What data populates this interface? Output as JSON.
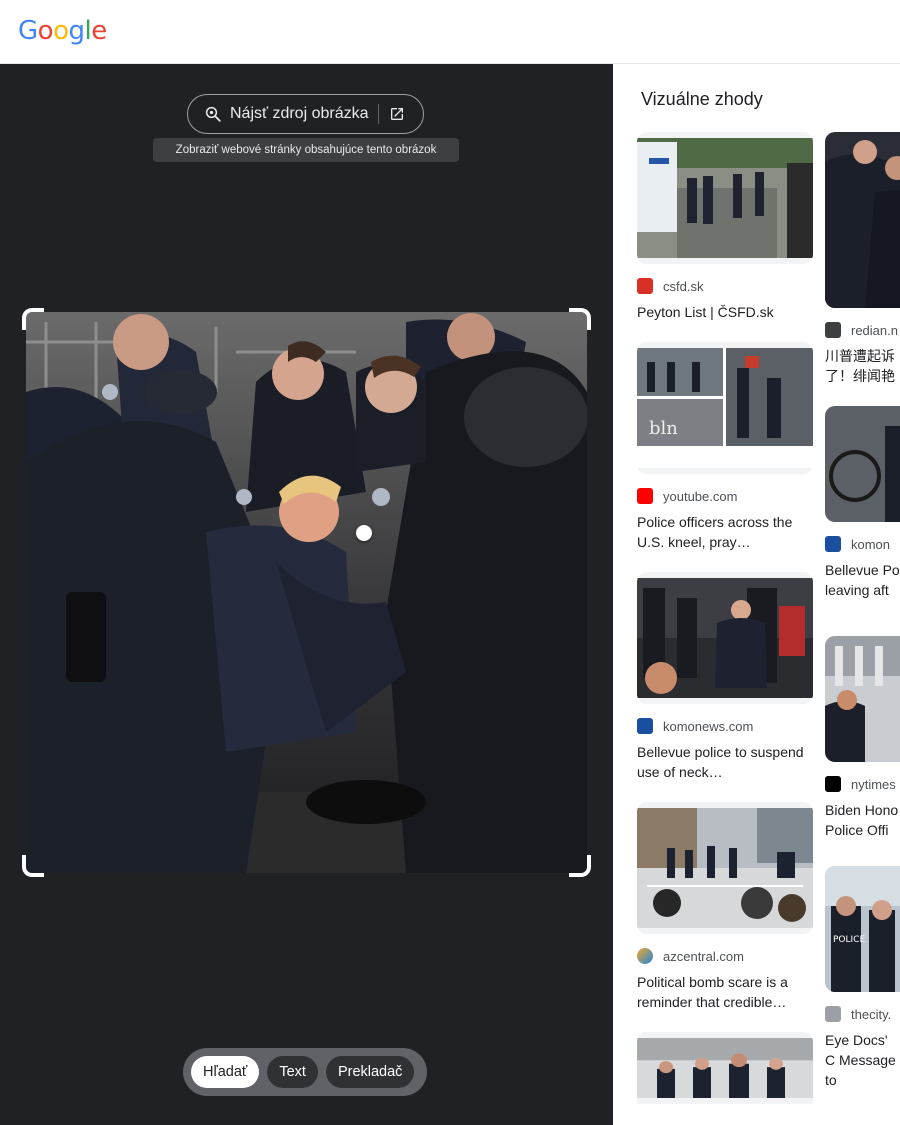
{
  "header": {
    "logo": "Google"
  },
  "left": {
    "find_source_label": "Nájsť zdroj obrázka",
    "tooltip": "Zobraziť webové stránky obsahujúce tento obrázok",
    "modes": [
      "Hľadať",
      "Text",
      "Prekladač"
    ],
    "active_mode": "Hľadať"
  },
  "right": {
    "title": "Vizuálne zhody",
    "col1": [
      {
        "source": "csfd.sk",
        "title": "Peyton List | ČSFD.sk",
        "favicon_color": "#d93025"
      },
      {
        "source": "youtube.com",
        "title": "Police officers across the U.S. kneel, pray…",
        "favicon_color": "#ff0000"
      },
      {
        "source": "komonews.com",
        "title": "Bellevue police to suspend use of neck…",
        "favicon_color": "#1a4fa0"
      },
      {
        "source": "azcentral.com",
        "title": "Political bomb scare is a reminder that credible…",
        "favicon_color": "#f5a623"
      },
      {
        "source": "",
        "title": "",
        "favicon_color": "#cccccc"
      }
    ],
    "col2": [
      {
        "source": "redian.n",
        "title": "川普遭起诉了！绯闻艳",
        "favicon_color": "#3c4043"
      },
      {
        "source": "komon",
        "title": "Bellevue Po leaving aft",
        "favicon_color": "#1a4fa0"
      },
      {
        "source": "nytimes",
        "title": "Biden Hono Police Offi",
        "favicon_color": "#000000"
      },
      {
        "source": "thecity.",
        "title": "Eye Docs' C Message to",
        "favicon_color": "#9aa0a6"
      }
    ]
  },
  "colors": {
    "dark_bg": "#202124",
    "accent_blue": "#4285F4"
  }
}
